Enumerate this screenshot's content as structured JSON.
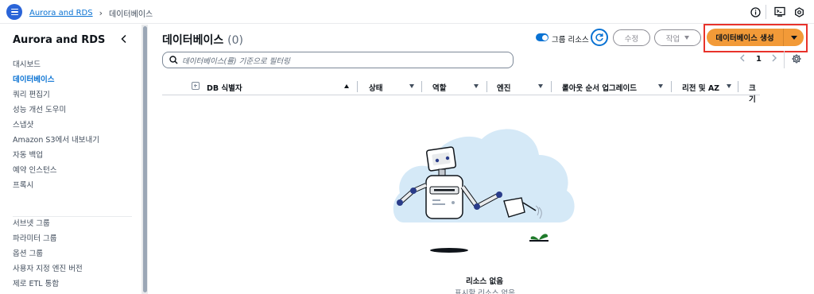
{
  "topbar": {
    "breadcrumb": {
      "service": "Aurora and RDS",
      "current": "데이터베이스"
    },
    "icons": [
      "info-icon",
      "cloudshell-icon",
      "settings-icon"
    ]
  },
  "sidebar": {
    "title": "Aurora and RDS",
    "items": [
      {
        "label": "대시보드",
        "active": false
      },
      {
        "label": "데이터베이스",
        "active": true
      },
      {
        "label": "쿼리 편집기",
        "active": false
      },
      {
        "label": "성능 개선 도우미",
        "active": false
      },
      {
        "label": "스냅샷",
        "active": false
      },
      {
        "label": "Amazon S3에서 내보내기",
        "active": false
      },
      {
        "label": "자동 백업",
        "active": false
      },
      {
        "label": "예약 인스턴스",
        "active": false
      },
      {
        "label": "프록시",
        "active": false
      }
    ],
    "items2": [
      {
        "label": "서브넷 그룹"
      },
      {
        "label": "파라미터 그룹"
      },
      {
        "label": "옵션 그룹"
      },
      {
        "label": "사용자 지정 엔진 버전"
      },
      {
        "label": "제로 ETL 통합"
      }
    ]
  },
  "main": {
    "title": "데이터베이스",
    "count": "(0)",
    "group_toggle_label": "그룹 리소스",
    "group_toggle_on": true,
    "modify_label": "수정",
    "actions_label": "작업",
    "create_label": "데이터베이스 생성",
    "search_placeholder": "데이터베이스(를) 기준으로 필터링",
    "page": "1",
    "columns": [
      "DB 식별자",
      "상태",
      "역할",
      "엔진",
      "롤아웃 순서 업그레이드",
      "리전 및 AZ",
      "크기"
    ],
    "empty_title": "리소스 없음",
    "empty_sub": "표시할 리소스 없음"
  },
  "colors": {
    "accent": "#0972d3",
    "primary_button": "#f29a38",
    "highlight_outline": "#e8322b"
  }
}
